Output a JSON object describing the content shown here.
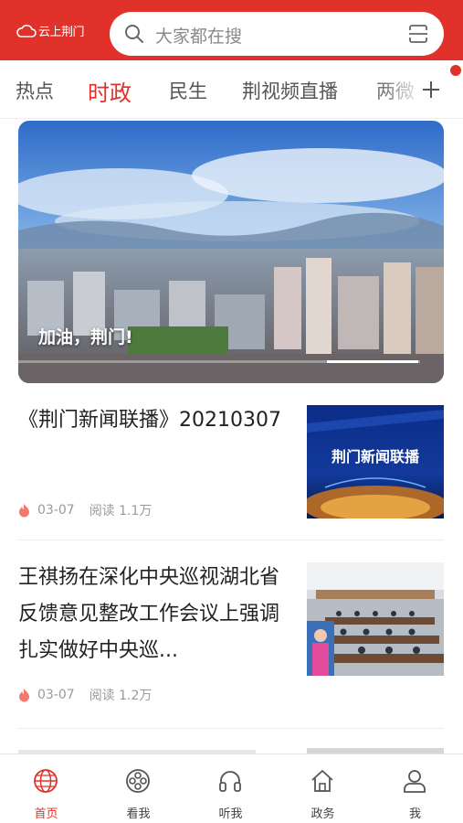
{
  "header": {
    "logo_text": "云上荆门",
    "search_placeholder": "大家都在搜"
  },
  "tabs": [
    {
      "label": "热点"
    },
    {
      "label": "时政"
    },
    {
      "label": "民生"
    },
    {
      "label": "荆视频直播"
    },
    {
      "label": "两微"
    }
  ],
  "active_tab": "时政",
  "hero": {
    "title": "加油，荆门!"
  },
  "news": [
    {
      "title": "《荆门新闻联播》20210307",
      "date": "03-07",
      "reads": "阅读 1.1万",
      "thumb_text": "荆门新闻联播"
    },
    {
      "title": "王祺扬在深化中央巡视湖北省反馈意见整改工作会议上强调　扎实做好中央巡...",
      "date": "03-07",
      "reads": "阅读 1.2万"
    }
  ],
  "bottom_nav": [
    {
      "label": "首页",
      "icon": "globe-icon",
      "active": true
    },
    {
      "label": "看我",
      "icon": "film-reel-icon",
      "active": false
    },
    {
      "label": "听我",
      "icon": "headphones-icon",
      "active": false
    },
    {
      "label": "政务",
      "icon": "home-icon",
      "active": false
    },
    {
      "label": "我",
      "icon": "user-icon",
      "active": false
    }
  ],
  "colors": {
    "brand_red": "#e0322a",
    "text_dark": "#222222",
    "text_meta": "#9a9a9a"
  }
}
